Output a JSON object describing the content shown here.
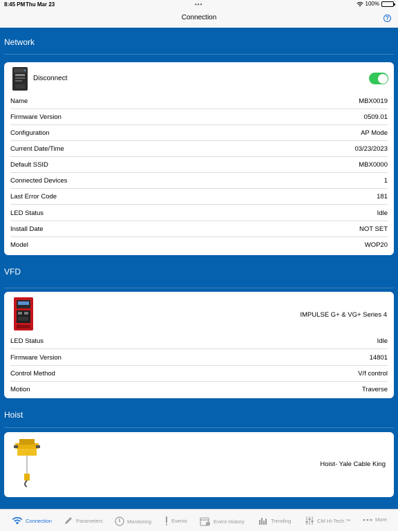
{
  "status_bar": {
    "time": "8:45 PM",
    "date": "Thu Mar 23",
    "battery": "100%"
  },
  "nav": {
    "title": "Connection"
  },
  "network": {
    "title": "Network",
    "connection_label": "Disconnect",
    "connected": true,
    "rows": [
      {
        "label": "Name",
        "value": "MBX0019"
      },
      {
        "label": "Firmware Version",
        "value": "0509.01"
      },
      {
        "label": "Configuration",
        "value": "AP Mode"
      },
      {
        "label": "Current Date/Time",
        "value": "03/23/2023"
      },
      {
        "label": "Default SSID",
        "value": "MBX0000"
      },
      {
        "label": "Connected Devices",
        "value": "1"
      },
      {
        "label": "Last Error Code",
        "value": "181"
      },
      {
        "label": "LED Status",
        "value": "Idle"
      },
      {
        "label": "Install Date",
        "value": "NOT SET"
      },
      {
        "label": "Model",
        "value": "WOP20"
      }
    ]
  },
  "vfd": {
    "title": "VFD",
    "device_name": "IMPULSE G+ & VG+ Series 4",
    "rows": [
      {
        "label": "LED Status",
        "value": "Idle"
      },
      {
        "label": "Firmware Version",
        "value": "14801"
      },
      {
        "label": "Control Method",
        "value": "V/f control"
      },
      {
        "label": "Motion",
        "value": "Traverse"
      }
    ]
  },
  "hoist": {
    "title": "Hoist",
    "device_name": "Hoist- Yale Cable King"
  },
  "tabs": [
    {
      "label": "Connection",
      "icon": "wifi-icon",
      "active": true
    },
    {
      "label": "Parameters",
      "icon": "pencil-icon",
      "active": false
    },
    {
      "label": "Monitoring",
      "icon": "gauge-icon",
      "active": false
    },
    {
      "label": "Events",
      "icon": "exclamation-icon",
      "active": false
    },
    {
      "label": "Event History",
      "icon": "calendar-alert-icon",
      "active": false
    },
    {
      "label": "Trending",
      "icon": "bar-chart-icon",
      "active": false
    },
    {
      "label": "CM Hi-Tech ™",
      "icon": "sliders-icon",
      "active": false
    },
    {
      "label": "More",
      "icon": "ellipsis-icon",
      "active": false
    }
  ],
  "colors": {
    "accent": "#1a6fd6",
    "content_bg": "#0560ad",
    "toggle_on": "#34c759"
  }
}
